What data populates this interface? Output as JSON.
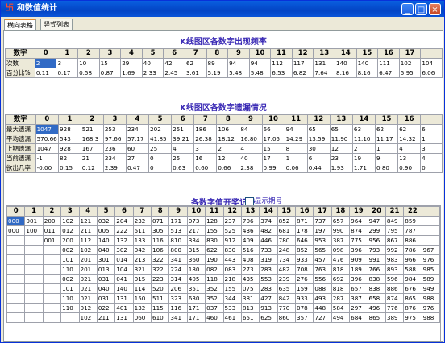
{
  "window": {
    "title": "和数值统计",
    "icon_glyph": "卐"
  },
  "tabs": [
    "横向表格",
    "竖式列表"
  ],
  "section1": {
    "title": "K线图区各数字出现频率",
    "header": [
      "数字",
      "0",
      "1",
      "2",
      "3",
      "4",
      "5",
      "6",
      "7",
      "8",
      "9",
      "10",
      "11",
      "12",
      "13",
      "14",
      "15",
      "16",
      "17"
    ],
    "rows": [
      [
        "次数",
        "2",
        "3",
        "10",
        "15",
        "29",
        "40",
        "42",
        "62",
        "89",
        "94",
        "94",
        "112",
        "117",
        "131",
        "140",
        "140",
        "111",
        "102",
        "104"
      ],
      [
        "百分比%",
        "0.11",
        "0.17",
        "0.58",
        "0.87",
        "1.69",
        "2.33",
        "2.45",
        "3.61",
        "5.19",
        "5.48",
        "5.48",
        "6.53",
        "6.82",
        "7.64",
        "8.16",
        "8.16",
        "6.47",
        "5.95",
        "6.06"
      ]
    ]
  },
  "section2": {
    "title": "K线图区各数字遗漏情况",
    "header": [
      "数字",
      "0",
      "1",
      "2",
      "3",
      "4",
      "5",
      "6",
      "7",
      "8",
      "9",
      "10",
      "11",
      "12",
      "13",
      "14",
      "15",
      "16"
    ],
    "rows": [
      [
        "最大遗漏",
        "1047",
        "928",
        "521",
        "253",
        "234",
        "202",
        "251",
        "186",
        "106",
        "84",
        "66",
        "94",
        "65",
        "65",
        "63",
        "62",
        "62",
        "6"
      ],
      [
        "平均遗漏",
        "570.66",
        "543",
        "168.3",
        "97.66",
        "57.17",
        "41.85",
        "39.21",
        "26.38",
        "18.12",
        "16.80",
        "17.05",
        "14.29",
        "13.59",
        "11.90",
        "11.10",
        "11.17",
        "14.32",
        "1"
      ],
      [
        "上期遗漏",
        "1047",
        "928",
        "167",
        "236",
        "60",
        "25",
        "4",
        "3",
        "2",
        "4",
        "15",
        "8",
        "30",
        "12",
        "2",
        "1",
        "4",
        "3"
      ],
      [
        "当前遗漏",
        "-1",
        "82",
        "21",
        "234",
        "27",
        "0",
        "25",
        "16",
        "12",
        "40",
        "17",
        "1",
        "6",
        "23",
        "19",
        "9",
        "13",
        "4"
      ],
      [
        "欲出几率",
        "-0.00",
        "0.15",
        "0.12",
        "2.39",
        "0.47",
        "0",
        "0.63",
        "0.60",
        "0.66",
        "2.38",
        "0.99",
        "0.06",
        "0.44",
        "1.93",
        "1.71",
        "0.80",
        "0.90",
        "0"
      ]
    ]
  },
  "section3": {
    "title": "各数字值开奖记录",
    "checkbox_label": "显示期号",
    "header": [
      "0",
      "1",
      "2",
      "3",
      "4",
      "5",
      "6",
      "7",
      "8",
      "9",
      "10",
      "11",
      "12",
      "13",
      "14",
      "15",
      "16",
      "17",
      "18",
      "19",
      "20",
      "21",
      "22"
    ],
    "rows": [
      [
        "000",
        "001",
        "200",
        "102",
        "121",
        "032",
        "204",
        "232",
        "071",
        "171",
        "073",
        "128",
        "237",
        "706",
        "374",
        "852",
        "871",
        "737",
        "657",
        "964",
        "947",
        "849",
        "859"
      ],
      [
        "000",
        "100",
        "011",
        "012",
        "211",
        "005",
        "222",
        "511",
        "305",
        "513",
        "217",
        "155",
        "525",
        "436",
        "482",
        "681",
        "178",
        "197",
        "990",
        "874",
        "299",
        "795",
        "787"
      ],
      [
        "",
        "",
        "001",
        "200",
        "112",
        "140",
        "132",
        "133",
        "116",
        "810",
        "334",
        "830",
        "912",
        "409",
        "446",
        "780",
        "646",
        "953",
        "387",
        "775",
        "956",
        "867",
        "886"
      ],
      [
        "",
        "",
        "",
        "002",
        "102",
        "040",
        "302",
        "042",
        "106",
        "800",
        "315",
        "622",
        "830",
        "516",
        "733",
        "248",
        "852",
        "565",
        "098",
        "396",
        "793",
        "992",
        "786",
        "967"
      ],
      [
        "",
        "",
        "",
        "101",
        "201",
        "301",
        "014",
        "213",
        "322",
        "341",
        "360",
        "190",
        "443",
        "408",
        "319",
        "734",
        "933",
        "457",
        "476",
        "909",
        "991",
        "983",
        "966",
        "976"
      ],
      [
        "",
        "",
        "",
        "110",
        "201",
        "013",
        "104",
        "321",
        "322",
        "224",
        "180",
        "082",
        "083",
        "273",
        "283",
        "482",
        "708",
        "763",
        "818",
        "189",
        "766",
        "893",
        "588",
        "985"
      ],
      [
        "",
        "",
        "",
        "002",
        "021",
        "031",
        "041",
        "015",
        "223",
        "314",
        "405",
        "118",
        "218",
        "435",
        "553",
        "239",
        "276",
        "556",
        "692",
        "396",
        "838",
        "596",
        "984",
        "589"
      ],
      [
        "",
        "",
        "",
        "101",
        "021",
        "040",
        "140",
        "114",
        "520",
        "206",
        "351",
        "352",
        "155",
        "075",
        "283",
        "635",
        "159",
        "088",
        "818",
        "657",
        "838",
        "886",
        "676",
        "949"
      ],
      [
        "",
        "",
        "",
        "110",
        "021",
        "031",
        "131",
        "150",
        "511",
        "323",
        "630",
        "352",
        "344",
        "381",
        "427",
        "842",
        "933",
        "493",
        "287",
        "387",
        "658",
        "874",
        "865",
        "988"
      ],
      [
        "",
        "",
        "",
        "110",
        "012",
        "022",
        "401",
        "132",
        "115",
        "116",
        "171",
        "037",
        "533",
        "813",
        "913",
        "770",
        "078",
        "448",
        "584",
        "297",
        "496",
        "776",
        "876",
        "976"
      ],
      [
        "",
        "",
        "",
        "",
        "102",
        "211",
        "131",
        "060",
        "610",
        "341",
        "171",
        "460",
        "461",
        "651",
        "625",
        "860",
        "357",
        "727",
        "494",
        "684",
        "865",
        "389",
        "975",
        "988"
      ]
    ]
  }
}
